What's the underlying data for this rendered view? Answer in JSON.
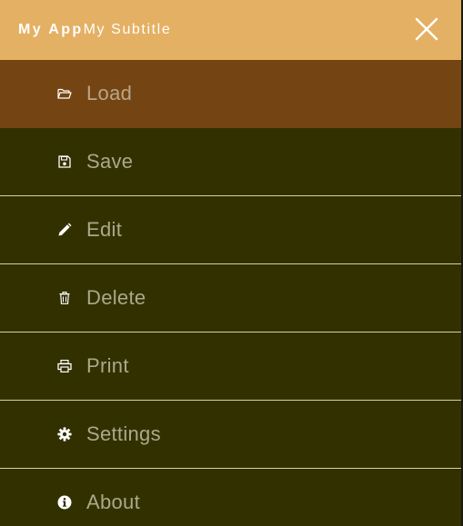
{
  "header": {
    "title": "My App",
    "subtitle": "My Subtitle",
    "close_icon": "close-icon"
  },
  "menu": {
    "items": [
      {
        "label": "Load",
        "icon": "folder-open-icon",
        "active": true
      },
      {
        "label": "Save",
        "icon": "floppy-disk-icon",
        "active": false
      },
      {
        "label": "Edit",
        "icon": "pencil-icon",
        "active": false
      },
      {
        "label": "Delete",
        "icon": "trash-icon",
        "active": false
      },
      {
        "label": "Print",
        "icon": "printer-icon",
        "active": false
      },
      {
        "label": "Settings",
        "icon": "gear-icon",
        "active": false
      },
      {
        "label": "About",
        "icon": "info-icon",
        "active": false
      }
    ]
  },
  "colors": {
    "header_bg": "#e4b063",
    "menu_bg": "#333000",
    "active_bg": "#744512",
    "label_color": "#aaa98a",
    "divider": "#d7d39a"
  }
}
